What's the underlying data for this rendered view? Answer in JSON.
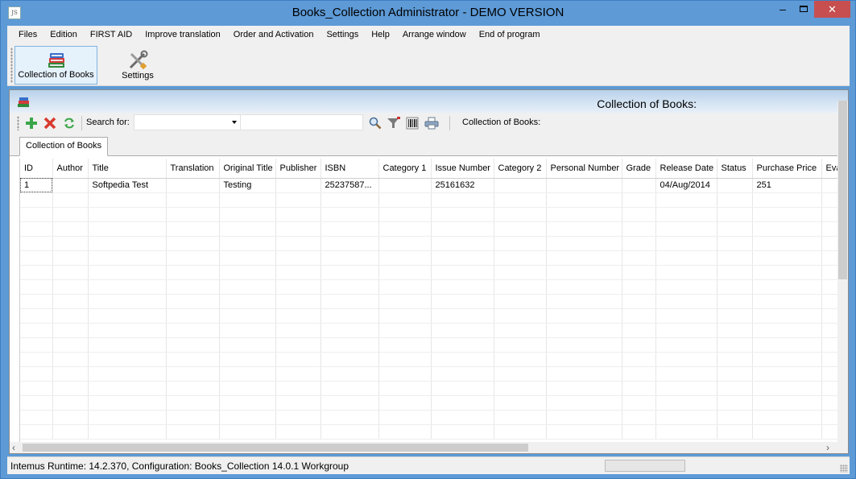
{
  "window": {
    "title": "Books_Collection  Administrator - DEMO VERSION",
    "icon_text": "JS",
    "minimize": "–",
    "close": "✕"
  },
  "menu": [
    "Files",
    "Edition",
    "FIRST AID",
    "Improve translation",
    "Order and Activation",
    "Settings",
    "Help",
    "Arrange window",
    "End of program"
  ],
  "toolbar": {
    "collection_label": "Collection of Books",
    "settings_label": "Settings"
  },
  "panel": {
    "title": "Collection of Books:",
    "search_label": "Search for:",
    "search_value": "",
    "right_label": "Collection of Books:",
    "tab_label": "Collection of Books"
  },
  "grid": {
    "columns": [
      "ID",
      "Author",
      "Title",
      "Translation",
      "Original Title",
      "Publisher",
      "ISBN",
      "Category 1",
      "Issue Number",
      "Category 2",
      "Personal Number",
      "Grade",
      "Release Date",
      "Status",
      "Purchase Price",
      "Eva"
    ],
    "rows": [
      [
        "1",
        "",
        "Softpedia Test",
        "",
        "Testing",
        "",
        "25237587...",
        "",
        "25161632",
        "",
        "",
        "",
        "04/Aug/2014",
        "",
        "251",
        ""
      ]
    ]
  },
  "status": {
    "text": "Intemus Runtime: 14.2.370,  Configuration: Books_Collection 14.0.1 Workgroup"
  },
  "icons": {
    "add": "plus-icon",
    "delete": "delete-icon",
    "refresh": "refresh-icon",
    "search": "magnifier-icon",
    "filter": "filter-icon",
    "barcode": "barcode-icon",
    "print": "printer-icon"
  },
  "colors": {
    "titlebar": "#5d9ad6",
    "close_button": "#c74f4f",
    "panel_header": "#c7dbef"
  }
}
